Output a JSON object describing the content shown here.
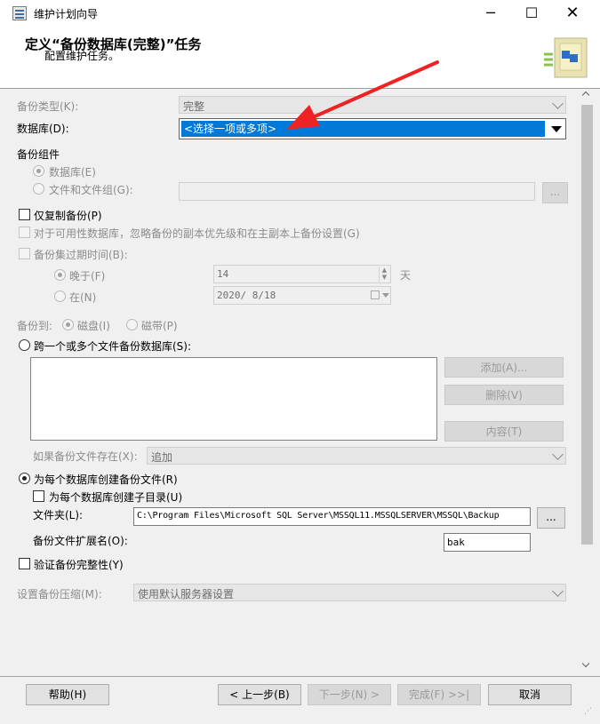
{
  "window": {
    "title": "维护计划向导",
    "min_icon": "minimize-icon",
    "max_icon": "maximize-icon",
    "close_icon": "close-icon"
  },
  "header": {
    "title": "定义“备份数据库(完整)”任务",
    "subtitle": "配置维护任务。"
  },
  "form": {
    "backup_type_label": "备份类型(K):",
    "backup_type_value": "完整",
    "database_label": "数据库(D):",
    "database_value": "<选择一项或多项>",
    "component_label": "备份组件",
    "component_db": "数据库(E)",
    "component_files": "文件和文件组(G):",
    "copy_only": "仅复制备份(P)",
    "ag_option": "对于可用性数据库，忽略备份的副本优先级和在主副本上备份设置(G)",
    "expire_label": "备份集过期时间(B):",
    "expire_after": "晚于(F)",
    "expire_after_value": "14",
    "expire_unit": "天",
    "expire_on": "在(N)",
    "expire_on_value": "2020/ 8/18",
    "backup_to_label": "备份到:",
    "backup_to_disk": "磁盘(I)",
    "backup_to_tape": "磁带(P)",
    "span_files": "跨一个或多个文件备份数据库(S):",
    "add_btn": "添加(A)...",
    "remove_btn": "删除(V)",
    "contents_btn": "内容(T)",
    "if_exists_label": "如果备份文件存在(X):",
    "if_exists_value": "追加",
    "per_db_file": "为每个数据库创建备份文件(R)",
    "per_db_subdir": "为每个数据库创建子目录(U)",
    "folder_label": "文件夹(L):",
    "folder_value": "C:\\Program Files\\Microsoft SQL Server\\MSSQL11.MSSQLSERVER\\MSSQL\\Backup",
    "browse_btn": "...",
    "ext_label": "备份文件扩展名(O):",
    "ext_value": "bak",
    "verify": "验证备份完整性(Y)",
    "compress_label": "设置备份压缩(M):",
    "compress_value": "使用默认服务器设置"
  },
  "footer": {
    "help": "帮助(H)",
    "back": "< 上一步(B)",
    "next": "下一步(N) >",
    "finish": "完成(F) >>|",
    "cancel": "取消"
  },
  "colors": {
    "selection": "#0078d7",
    "arrow": "#ee2222"
  }
}
